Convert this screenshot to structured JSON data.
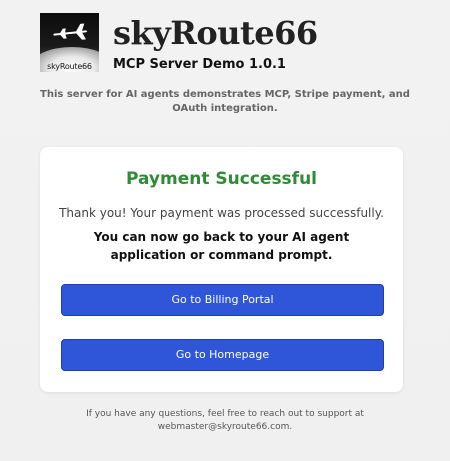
{
  "header": {
    "logo_text": "skyRoute66",
    "brand": "skyRoute66",
    "version": "MCP Server Demo 1.0.1",
    "tagline": "This server for AI agents demonstrates MCP, Stripe payment, and OAuth integration."
  },
  "card": {
    "title": "Payment Successful",
    "thanks": "Thank you! Your payment was processed successfully.",
    "goback": "You can now go back to your AI agent application or command prompt.",
    "billing_button": "Go to Billing Portal",
    "home_button": "Go to Homepage"
  },
  "footer": {
    "text": "If you have any questions, feel free to reach out to support at webmaster@skyroute66.com."
  },
  "colors": {
    "success": "#2e8b36",
    "button": "#2f55d8"
  },
  "icons": {
    "logo": "airplane-icon"
  }
}
